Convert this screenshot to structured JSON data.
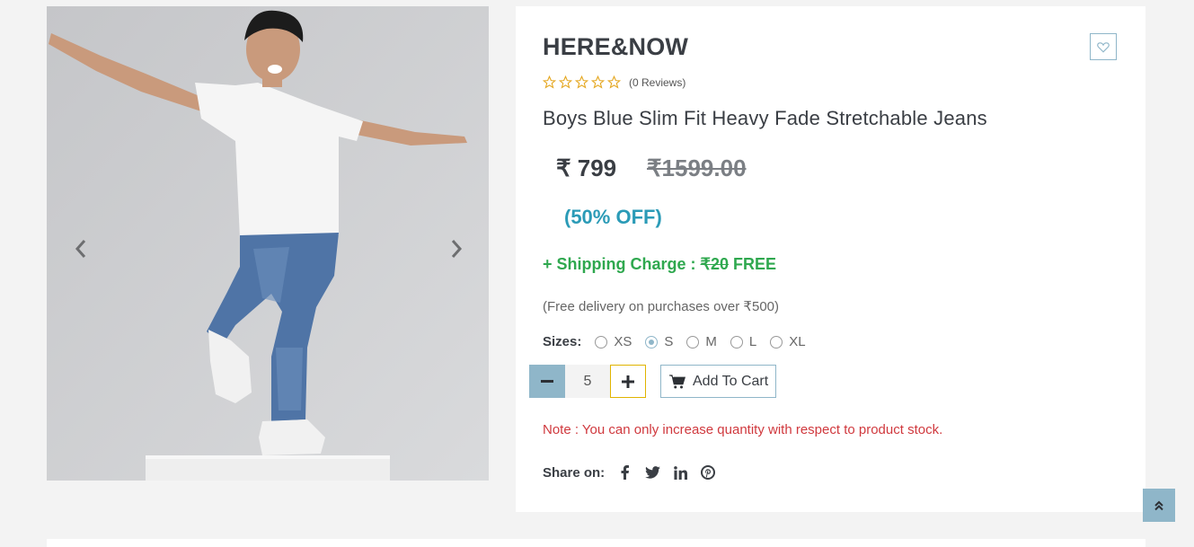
{
  "product": {
    "brand": "HERE&NOW",
    "reviews_text": "(0 Reviews)",
    "rating": 0,
    "rating_max": 5,
    "title": "Boys Blue Slim Fit Heavy Fade Stretchable Jeans",
    "price": "₹ 799",
    "mrp": "₹1599.00",
    "discount": "(50% OFF)",
    "shipping_prefix": "+ Shipping Charge : ",
    "shipping_original": "₹20",
    "shipping_free": "FREE",
    "free_delivery_note": "(Free delivery on purchases over ₹500)"
  },
  "sizes": {
    "label": "Sizes:",
    "options": [
      "XS",
      "S",
      "M",
      "L",
      "XL"
    ],
    "selected": "S"
  },
  "cart": {
    "quantity": "5",
    "add_label": "Add To Cart",
    "note": "Note : You can only increase quantity with respect to product stock."
  },
  "share": {
    "label": "Share on:",
    "icons": [
      "facebook-icon",
      "twitter-icon",
      "linkedin-icon",
      "pinterest-icon"
    ]
  },
  "colors": {
    "accent": "#8fb6c9",
    "discount": "#2b9bb7",
    "shipping": "#2fa84f",
    "note": "#d0393e",
    "star": "#e5a823",
    "plus_border": "#e0b400"
  }
}
